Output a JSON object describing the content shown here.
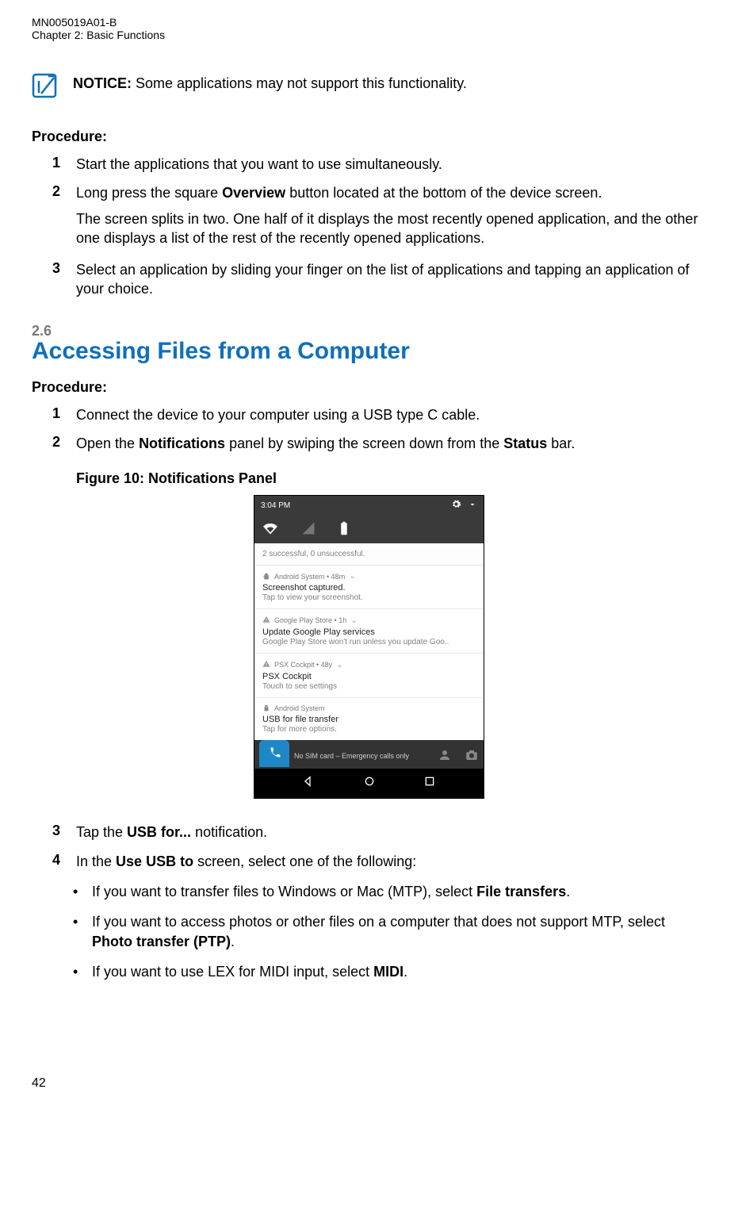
{
  "header": {
    "doc_id": "MN005019A01-B",
    "chapter": "Chapter 2:  Basic Functions"
  },
  "notice": {
    "label": "NOTICE:",
    "text": " Some applications may not support this functionality."
  },
  "proc1": {
    "label": "Procedure:",
    "step1": "Start the applications that you want to use simultaneously.",
    "step2_pre": "Long press the square ",
    "step2_bold": "Overview",
    "step2_post": " button located at the bottom of the device screen.",
    "step2_sub": "The screen splits in two. One half of it displays the most recently opened application, and the other one displays a list of the rest of the recently opened applications.",
    "step3": "Select an application by sliding your finger on the list of applications and tapping an application of your choice."
  },
  "section": {
    "num": "2.6",
    "title": "Accessing Files from a Computer"
  },
  "proc2": {
    "label": "Procedure:",
    "step1": "Connect the device to your computer using a USB type C cable.",
    "step2_pre": "Open the ",
    "step2_b1": "Notifications",
    "step2_mid": " panel by swiping the screen down from the ",
    "step2_b2": "Status",
    "step2_post": " bar.",
    "figure_caption": "Figure 10: Notifications Panel",
    "step3_pre": "Tap the ",
    "step3_bold": "USB for...",
    "step3_post": " notification.",
    "step4_pre": "In the ",
    "step4_bold": "Use USB to",
    "step4_post": " screen, select one of the following:",
    "bullet1_pre": "If you want to transfer files to Windows or Mac (MTP), select ",
    "bullet1_bold": "File transfers",
    "bullet1_post": ".",
    "bullet2_pre": "If you want to access photos or other files on a computer that does not support MTP, select ",
    "bullet2_bold": "Photo transfer (PTP)",
    "bullet2_post": ".",
    "bullet3_pre": "If you want to use LEX for MIDI input, select ",
    "bullet3_bold": "MIDI",
    "bullet3_post": "."
  },
  "phone": {
    "time": "3:04 PM",
    "summary": "2 successful, 0 unsuccessful.",
    "n1_app": "Android System • 48m",
    "n1_title": "Screenshot captured.",
    "n1_sub": "Tap to view your screenshot.",
    "n2_app": "Google Play Store • 1h",
    "n2_title": "Update Google Play services",
    "n2_sub": "Google Play Store won't run unless you update Goo..",
    "n3_app": "PSX Cockpit • 48y",
    "n3_title": "PSX Cockpit",
    "n3_sub": "Touch to see settings",
    "n4_app": "Android System",
    "n4_title": "USB for file transfer",
    "n4_sub": "Tap for more options.",
    "sim": "No SIM card – Emergency calls only"
  },
  "page_num": "42",
  "nums": {
    "n1": "1",
    "n2": "2",
    "n3": "3",
    "n4": "4"
  },
  "chevron": "⌄",
  "bullet": "•"
}
